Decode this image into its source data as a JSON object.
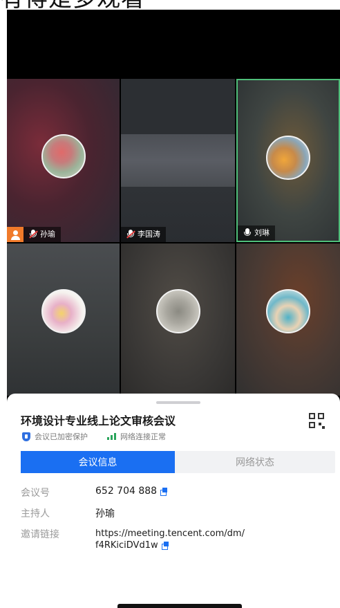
{
  "caption": "有得是多观看",
  "participants": [
    {
      "name": "孙瑜",
      "is_host": true,
      "muted": true
    },
    {
      "name": "李国涛",
      "is_host": false,
      "muted": true
    },
    {
      "name": "刘琳",
      "is_host": false,
      "muted": false,
      "speaking": true
    },
    {
      "name": "",
      "is_host": false,
      "muted": true
    },
    {
      "name": "",
      "is_host": false,
      "muted": true
    },
    {
      "name": "",
      "is_host": false,
      "muted": true
    }
  ],
  "meeting": {
    "title": "环境设计专业线上论文审核会议",
    "encryption_status": "会议已加密保护",
    "network_status": "网络连接正常",
    "tabs": {
      "info": "会议信息",
      "network": "网络状态",
      "active": "info"
    },
    "id_label": "会议号",
    "id_value": "652 704 888",
    "host_label": "主持人",
    "host_value": "孙瑜",
    "link_label": "邀请链接",
    "link_line1": "https://meeting.tencent.com/dm/",
    "link_line2": "f4RKiciDVd1w"
  },
  "colors": {
    "accent": "#1a6ff2",
    "speaking_border": "#4fbf7a",
    "host_badge": "#f07a2a",
    "signal_good": "#2aa55c"
  },
  "icons": [
    "host-icon",
    "mic-muted-icon",
    "mic-icon",
    "shield-icon",
    "signal-icon",
    "qr-code-icon",
    "copy-icon"
  ]
}
